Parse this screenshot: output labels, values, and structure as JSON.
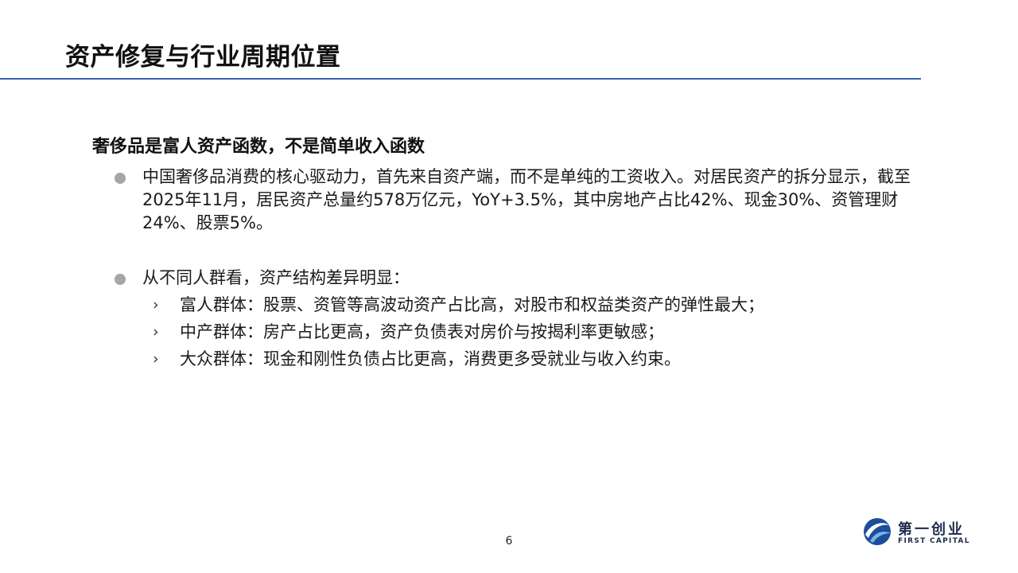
{
  "slide": {
    "title": "资产修复与行业周期位置",
    "subtitle": "奢侈品是富人资产函数，不是简单收入函数",
    "bullets": [
      {
        "text": "中国奢侈品消费的核心驱动力，首先来自资产端，而不是单纯的工资收入。对居民资产的拆分显示，截至2025年11月，居民资产总量约578万亿元，YoY+3.5%，其中房地产占比42%、现金30%、资管理财24%、股票5%。"
      },
      {
        "text": "从不同人群看，资产结构差异明显："
      }
    ],
    "sub_bullets": [
      {
        "marker": "›",
        "text": "富人群体：股票、资管等高波动资产占比高，对股市和权益类资产的弹性最大；"
      },
      {
        "marker": "›",
        "text": "中产群体：房产占比更高，资产负债表对房价与按揭利率更敏感；"
      },
      {
        "marker": "›",
        "text": "大众群体：现金和刚性负债占比更高，消费更多受就业与收入约束。"
      }
    ],
    "page_number": "6"
  },
  "logo": {
    "cn": "第一创业",
    "en": "FIRST CAPITAL"
  },
  "colors": {
    "title_rule": "#3a5fb0",
    "bullet_dot": "#a6a6a6",
    "logo_blue": "#1b4f9c"
  }
}
